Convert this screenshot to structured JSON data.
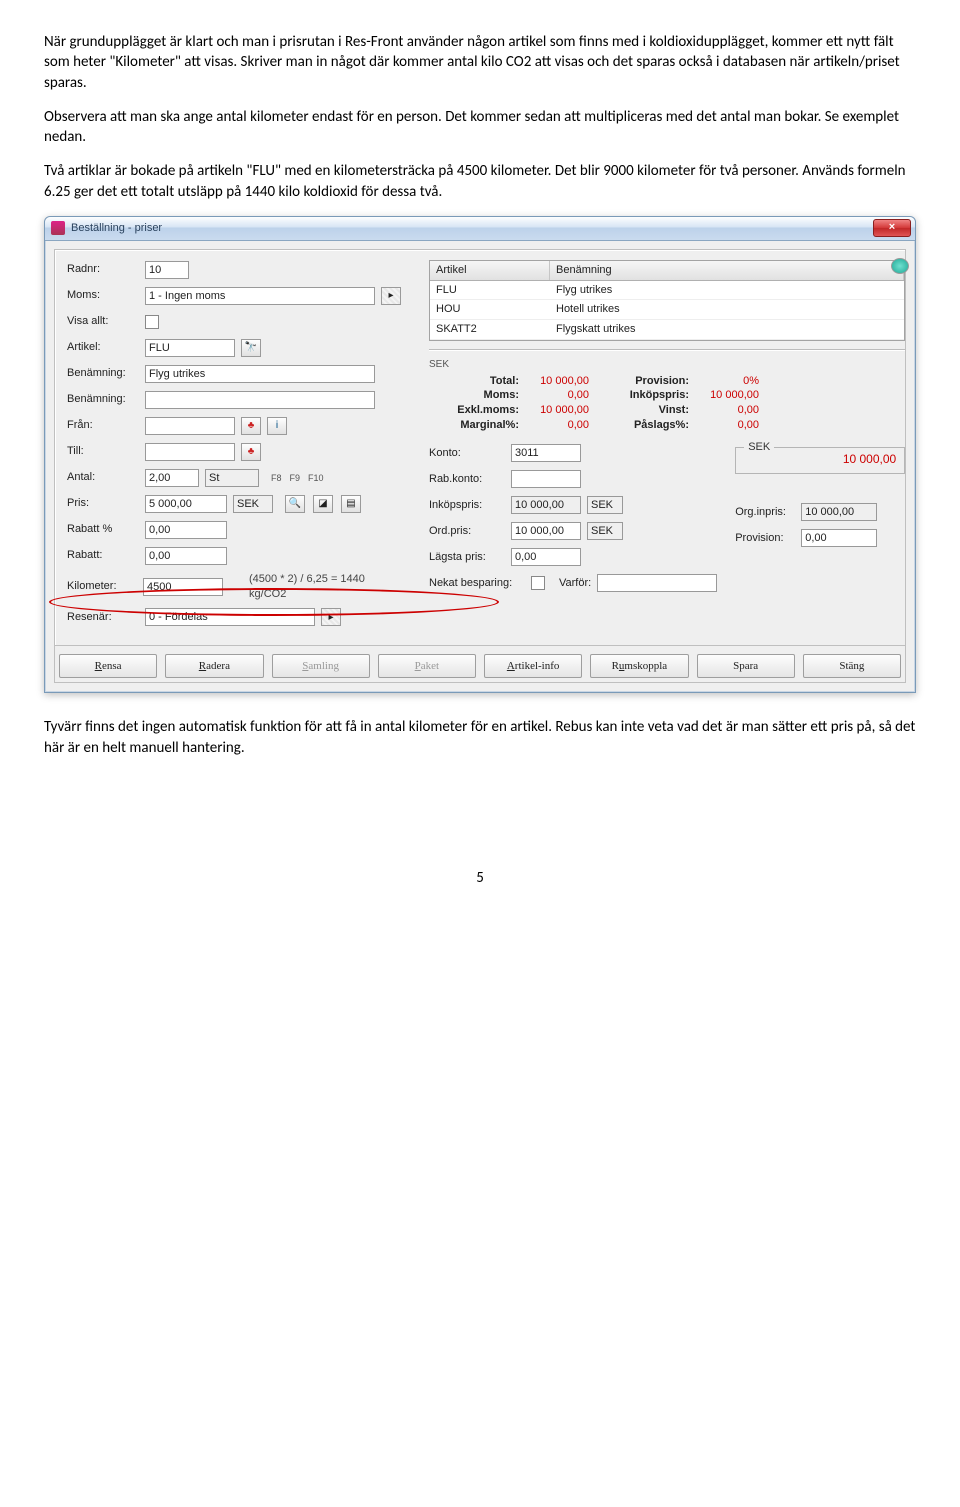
{
  "text": {
    "p1": "När grundupplägget är klart och man i prisrutan i Res-Front använder någon artikel som finns med i koldioxidupplägget, kommer ett nytt fält som heter \"Kilometer\" att visas. Skriver man in något där kommer antal kilo CO2 att visas och det sparas också i databasen när artikeln/priset sparas.",
    "p2": "Observera att man ska ange antal kilometer endast för en person. Det kommer sedan att multipliceras med det antal man bokar. Se exemplet nedan.",
    "p3": "Två artiklar är bokade på artikeln \"FLU\" med en kilometersträcka på 4500 kilometer. Det blir 9000 kilometer för två personer. Används formeln 6.25 ger det ett totalt utsläpp på 1440 kilo koldioxid för dessa två.",
    "p4": "Tyvärr finns det ingen automatisk funktion för att få in antal kilometer för en artikel. Rebus kan inte veta vad det är man sätter ett pris på, så det här är en helt manuell hantering.",
    "pagenum": "5"
  },
  "win": {
    "title": "Beställning - priser",
    "close": "×",
    "labels": {
      "radnr": "Radnr:",
      "moms": "Moms:",
      "visaallt": "Visa allt:",
      "artikel": "Artikel:",
      "benamning": "Benämning:",
      "benamning2": "Benämning:",
      "fran": "Från:",
      "till": "Till:",
      "antal": "Antal:",
      "pris": "Pris:",
      "rabattp": "Rabatt %",
      "rabatt": "Rabatt:",
      "kilometer": "Kilometer:",
      "resenar": "Resenär:",
      "konto": "Konto:",
      "rabkonto": "Rab.konto:",
      "inkopspris": "Inköpspris:",
      "ordpris": "Ord.pris:",
      "lagstapris": "Lägsta pris:",
      "nekat": "Nekat besparing:",
      "varfor": "Varför:",
      "orginpris": "Org.inpris:",
      "provision2": "Provision:"
    },
    "values": {
      "radnr": "10",
      "moms": "1 - Ingen moms",
      "artikel": "FLU",
      "benamning": "Flyg utrikes",
      "benamning2": "",
      "antal": "2,00",
      "antal_unit": "St",
      "pris": "5 000,00",
      "pris_cur": "SEK",
      "rabattp": "0,00",
      "rabatt": "0,00",
      "kilometer": "4500",
      "formula": "(4500 * 2) / 6,25 = 1440 kg/CO2",
      "resenar": "0   - Fördelas",
      "konto": "3011",
      "rabkonto": "",
      "inkopspris": "10 000,00",
      "inkopspris_cur": "SEK",
      "ordpris": "10 000,00",
      "ordpris_cur": "SEK",
      "lagstapris": "0,00",
      "orginpris": "10 000,00",
      "provision2": "0,00"
    },
    "fkeys": {
      "f8": "F8",
      "f9": "F9",
      "f10": "F10"
    },
    "table": {
      "h1": "Artikel",
      "h2": "Benämning",
      "rows": [
        {
          "a": "FLU",
          "b": "Flyg utrikes"
        },
        {
          "a": "HOU",
          "b": "Hotell utrikes"
        },
        {
          "a": "SKATT2",
          "b": "Flygskatt utrikes"
        }
      ]
    },
    "totals": {
      "cur": "SEK",
      "l1": "Total:",
      "v1": "10 000,00",
      "r1": "Provision:",
      "rv1": "0%",
      "l2": "Moms:",
      "v2": "0,00",
      "r2": "Inköpspris:",
      "rv2": "10 000,00",
      "l3": "Exkl.moms:",
      "v3": "10 000,00",
      "r3": "Vinst:",
      "rv3": "0,00",
      "l4": "Marginal%:",
      "v4": "0,00",
      "r4": "Påslags%:",
      "rv4": "0,00"
    },
    "sekbox": {
      "legend": "SEK",
      "val": "10 000,00"
    },
    "buttons": {
      "rensa": "Rensa",
      "radera": "Radera",
      "samling": "Samling",
      "paket": "Paket",
      "artikelinfo": "Artikel-info",
      "rumskoppla": "Rumskoppla",
      "spara": "Spara",
      "stang": "Stäng"
    }
  }
}
